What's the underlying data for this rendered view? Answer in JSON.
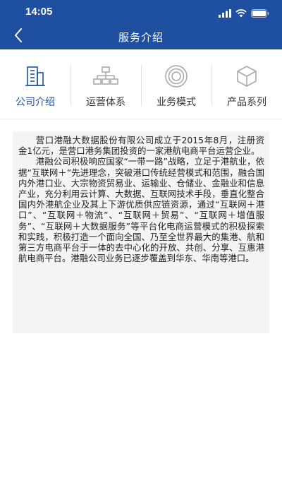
{
  "status_bar": {
    "time": "14:05"
  },
  "nav": {
    "title": "服务介绍",
    "back_icon": "chevron-left-icon"
  },
  "tabs": [
    {
      "label": "公司介绍",
      "icon": "building-icon",
      "active": true
    },
    {
      "label": "运营体系",
      "icon": "org-chart-icon",
      "active": false
    },
    {
      "label": "业务模式",
      "icon": "target-rings-icon",
      "active": false
    },
    {
      "label": "产品系列",
      "icon": "cube-icon",
      "active": false
    }
  ],
  "content": {
    "paragraphs": [
      "营口港融大数据股份有限公司成立于2015年8月，注册资金1亿元，是营口港务集团投资的一家港航电商平台运营企业。",
      "港融公司积极响应国家“一带一路”战略，立足于港航业，依据“互联网＋”先进理念，突破港口传统经营模式和范围，融合国内外港口业、大宗物资贸易业、运输业、仓储业、金融业和信息产业，充分利用云计算、大数据、互联网技术手段，垂直化整合国内外港航企业及其上下游优质供应链资源，通过“互联网＋港口”、“互联网＋物流”、“互联网＋贸易”、“互联网＋增值服务”、“互联网＋大数据服务”等平台化电商运营模式的积极探索和实践，积极打造一个面向全国、乃至全世界最大的集港、航和第三方电商平台于一体的去中心化的开放、共创、分享、互惠港航电商平台。港融公司业务已逐步覆盖到华东、华南等港口。"
    ]
  },
  "colors": {
    "primary": "#1f4f9f",
    "inactive_icon": "#a9a9a9",
    "card_bg": "#f4f4f4"
  }
}
